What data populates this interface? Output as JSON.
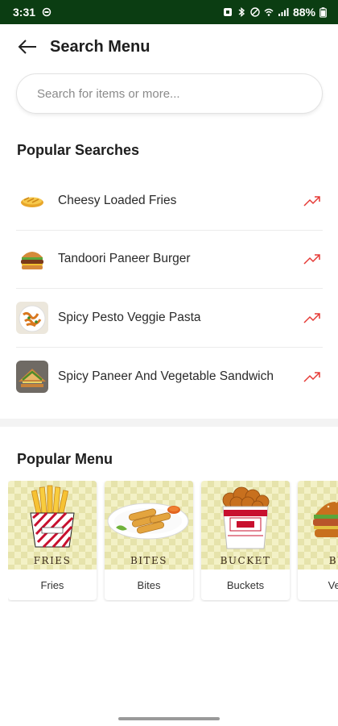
{
  "status_bar": {
    "time": "3:31",
    "battery": "88%",
    "bg_color": "#0b3d12"
  },
  "header": {
    "title": "Search Menu",
    "back_icon": "arrow-left-icon"
  },
  "search": {
    "placeholder": "Search for items or more...",
    "value": ""
  },
  "popular_searches": {
    "title": "Popular Searches",
    "trend_icon": "trending-up-icon",
    "trend_color": "#e53935",
    "items": [
      {
        "label": "Cheesy Loaded Fries",
        "icon": "fries-thumbnail"
      },
      {
        "label": "Tandoori Paneer Burger",
        "icon": "burger-thumbnail"
      },
      {
        "label": "Spicy Pesto Veggie Pasta",
        "icon": "pasta-thumbnail"
      },
      {
        "label": "Spicy Paneer And Vegetable Sandwich",
        "icon": "sandwich-thumbnail"
      }
    ]
  },
  "popular_menu": {
    "title": "Popular Menu",
    "cards": [
      {
        "label": "Fries",
        "caption": "FRIES",
        "icon": "fries-box-image"
      },
      {
        "label": "Bites",
        "caption": "BITES",
        "icon": "bites-plate-image"
      },
      {
        "label": "Buckets",
        "caption": "BUCKET",
        "icon": "chicken-bucket-image"
      },
      {
        "label": "Veg B",
        "caption": "BUR",
        "icon": "burger-image"
      }
    ]
  }
}
